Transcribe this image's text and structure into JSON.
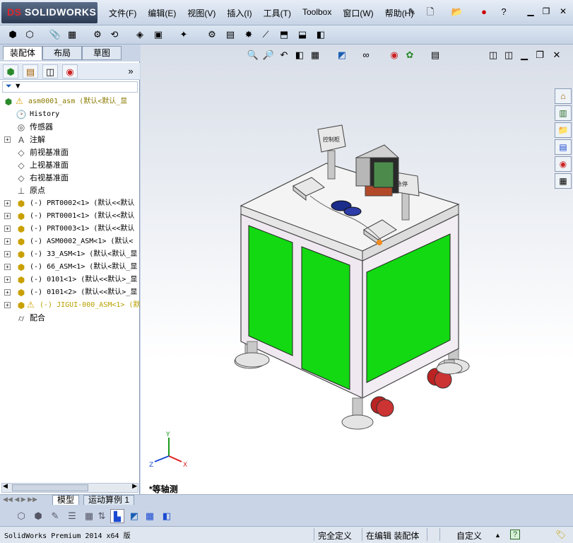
{
  "app": {
    "logo_ds": "DS",
    "logo_text": "SOLIDWORKS"
  },
  "menu": [
    "文件(F)",
    "编辑(E)",
    "视图(V)",
    "插入(I)",
    "工具(T)",
    "Toolbox",
    "窗口(W)",
    "帮助(H)"
  ],
  "tabs": [
    "装配体",
    "布局",
    "草图"
  ],
  "filter_icon": "▼",
  "tree": {
    "root": "asm0001_asm  (默认<默认_显",
    "items": [
      {
        "label": "History",
        "mono": true
      },
      {
        "label": "传感器"
      },
      {
        "label": "注解",
        "exp": "+"
      },
      {
        "label": "前视基准面"
      },
      {
        "label": "上视基准面"
      },
      {
        "label": "右视基准面"
      },
      {
        "label": "原点"
      },
      {
        "label": "(-) PRT0002<1> (默认<<默认",
        "exp": "+",
        "mono": true
      },
      {
        "label": "(-) PRT0001<1> (默认<<默认",
        "exp": "+",
        "mono": true
      },
      {
        "label": "(-) PRT0003<1> (默认<<默认",
        "exp": "+",
        "mono": true
      },
      {
        "label": "(-) ASM0002_ASM<1> (默认<",
        "exp": "+",
        "mono": true
      },
      {
        "label": "(-) 33_ASM<1> (默认<默认_显",
        "exp": "+",
        "mono": true
      },
      {
        "label": "(-) 66_ASM<1> (默认<默认_显",
        "exp": "+",
        "mono": true
      },
      {
        "label": "(-) 0101<1> (默认<<默认>_显",
        "exp": "+",
        "mono": true
      },
      {
        "label": "(-) 0101<2> (默认<<默认>_显",
        "exp": "+",
        "mono": true
      },
      {
        "label": "(-) JIGUI-000_ASM<1> (默",
        "exp": "+",
        "mono": true,
        "warn": true,
        "color": "#b8a000"
      },
      {
        "label": "配合"
      }
    ]
  },
  "viewport": {
    "view_label": "*等轴测",
    "triad": {
      "x": "X",
      "y": "Y",
      "z": "Z"
    },
    "box_left_label": "控制柜",
    "box_right_label": "急停"
  },
  "bottom_tabs": [
    "模型",
    "运动算例 1"
  ],
  "status": {
    "left": "SolidWorks Premium 2014 x64 版",
    "s1": "完全定义",
    "s2": "在编辑 装配体",
    "s3": "自定义",
    "s4": "▲",
    "help": "?"
  }
}
